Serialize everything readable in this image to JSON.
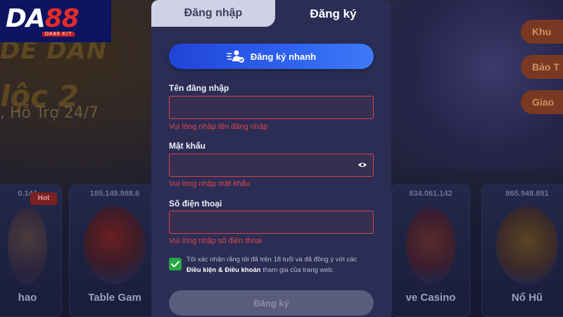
{
  "logo": {
    "brand_text": "DA",
    "brand_num": "88",
    "sub_text": "DA88 KIT"
  },
  "background": {
    "hero_line1": "DỄ DÀN",
    "hero_line2": "lộc 2",
    "hero_line3": ", Hỗ Trợ 24/7",
    "side_pills": [
      "Khu",
      "Bảo T",
      "Giao"
    ],
    "game_cards": [
      {
        "count": "0.144",
        "name": "hao",
        "hot": "Hot"
      },
      {
        "count": "185.149.988.6",
        "name": "Table Gam"
      },
      {
        "count": "834.061.142",
        "name": "ve Casino"
      },
      {
        "count": "865.948.851",
        "name": "Nổ Hũ"
      }
    ]
  },
  "modal": {
    "tabs": {
      "login": "Đăng nhập",
      "register": "Đăng ký"
    },
    "quick_register": "Đăng ký nhanh",
    "fields": {
      "username": {
        "label": "Tên đăng nhập",
        "value": "",
        "error": "Vui lòng nhập tên đăng nhập"
      },
      "password": {
        "label": "Mật khẩu",
        "value": "",
        "error": "Vui lòng nhập mật khẩu"
      },
      "phone": {
        "label": "Số điện thoại",
        "value": "",
        "error": "Vui lòng nhập số điện thoại"
      }
    },
    "terms": {
      "checked": true,
      "text_before": "Tôi xác nhận rằng tôi đã trên 18 tuổi và đã đồng ý với các ",
      "link": "Điều kiện & Điều khoản",
      "text_after": " tham gia của trang web."
    },
    "submit": "Đăng ký"
  },
  "colors": {
    "accent_blue": "#2f63f0",
    "error_red": "#e0474c",
    "checkbox_green": "#27a845",
    "modal_bg": "#2b2d55"
  }
}
